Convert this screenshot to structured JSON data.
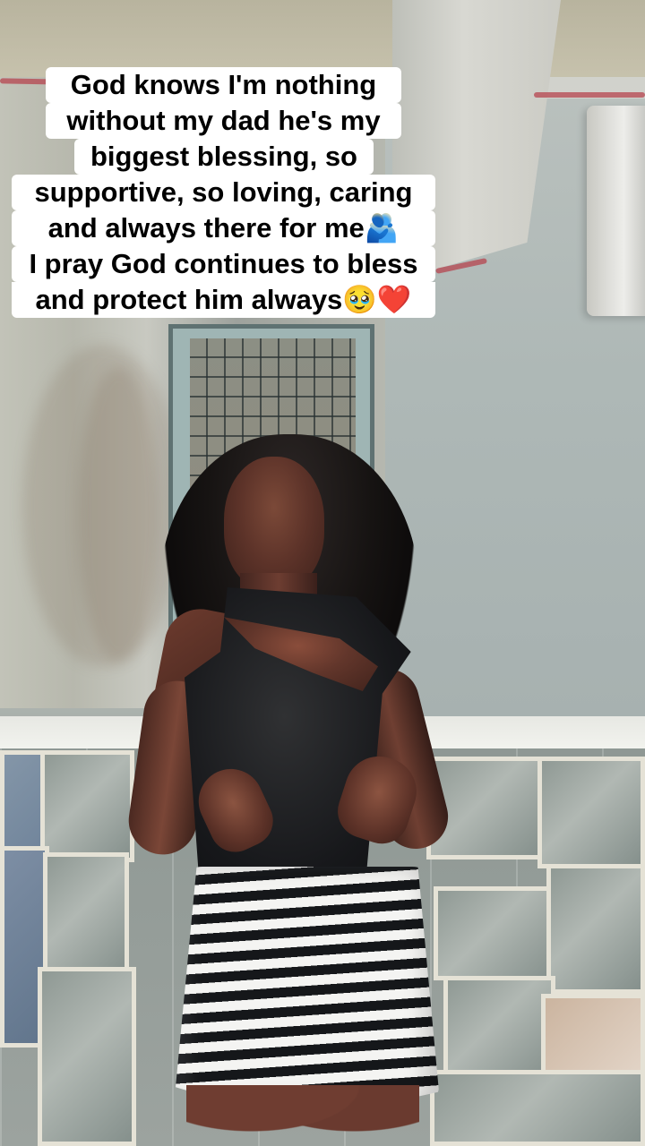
{
  "caption": {
    "lines": [
      "God knows I'm nothing",
      "without my dad he's my",
      "biggest blessing, so",
      "supportive, so loving, caring",
      "and always there for me🫂",
      "I pray God continues to bless",
      "and protect him always🥹❤️"
    ]
  },
  "scene": {
    "subject": "person-standing-outdoors",
    "background": "stone-wall-and-window"
  },
  "colors": {
    "caption_background": "#ffffff",
    "caption_text": "#000000"
  }
}
